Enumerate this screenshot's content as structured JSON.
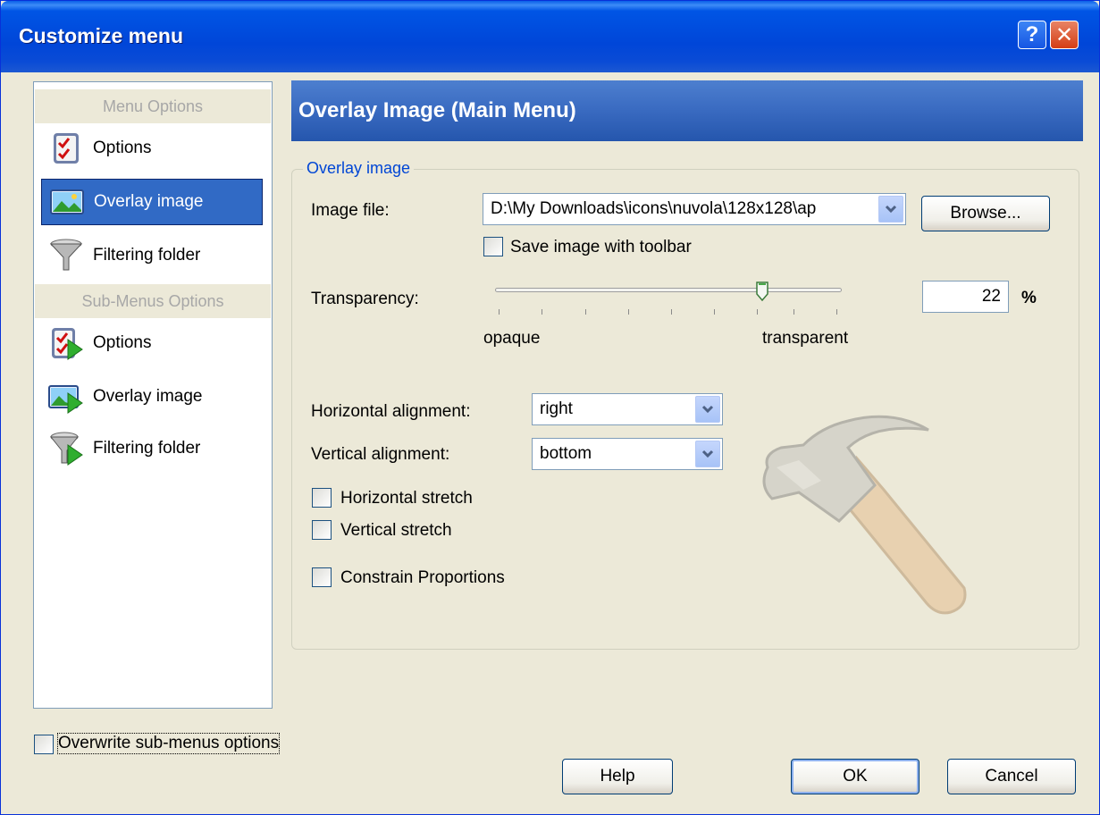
{
  "window": {
    "title": "Customize menu"
  },
  "titlebar": {
    "help_glyph": "?",
    "close_glyph": "✕"
  },
  "nav": {
    "menu_header": "Menu Options",
    "menu_items": [
      {
        "label": "Options",
        "icon": "checklist-icon"
      },
      {
        "label": "Overlay image",
        "icon": "image-icon"
      },
      {
        "label": "Filtering folder",
        "icon": "funnel-icon"
      }
    ],
    "submenu_header": "Sub-Menus Options",
    "submenu_items": [
      {
        "label": "Options",
        "icon": "checklist-arrow-icon"
      },
      {
        "label": "Overlay image",
        "icon": "image-arrow-icon"
      },
      {
        "label": "Filtering folder",
        "icon": "funnel-arrow-icon"
      }
    ],
    "selected": "Overlay image"
  },
  "panel": {
    "title": "Overlay Image (Main Menu)",
    "group_title": "Overlay image",
    "image_file_label": "Image file:",
    "image_file_value": "D:\\My Downloads\\icons\\nuvola\\128x128\\ap",
    "browse_label": "Browse...",
    "save_with_toolbar_label": "Save image with toolbar",
    "save_with_toolbar_checked": false,
    "transparency_label": "Transparency:",
    "transparency_value": "22",
    "transparency_unit": "%",
    "transparency_fraction": 0.75,
    "slider_min_label": "opaque",
    "slider_max_label": "transparent",
    "h_align_label": "Horizontal alignment:",
    "h_align_value": "right",
    "v_align_label": "Vertical alignment:",
    "v_align_value": "bottom",
    "h_stretch_label": "Horizontal stretch",
    "v_stretch_label": "Vertical stretch",
    "constrain_label": "Constrain Proportions",
    "preview_icon": "hammer-icon"
  },
  "footer": {
    "overwrite_label": "Overwrite sub-menus options",
    "help_label": "Help",
    "ok_label": "OK",
    "cancel_label": "Cancel"
  },
  "colors": {
    "titlebar": "#0055e5",
    "header_blue": "#2f62b8",
    "selection": "#316ac5",
    "legend": "#0046d5",
    "window_bg": "#ece9d8"
  }
}
